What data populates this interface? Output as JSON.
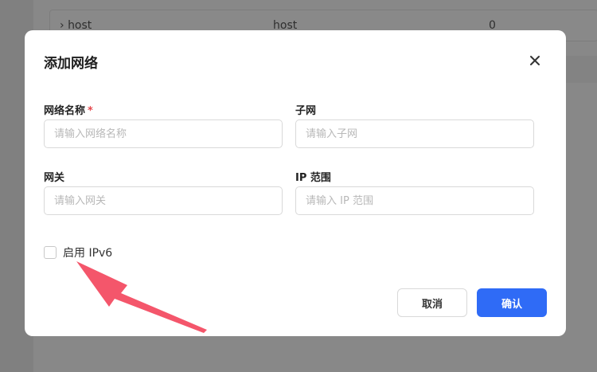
{
  "background": {
    "table_row": {
      "name": "host",
      "driver": "host",
      "count": "0"
    }
  },
  "dialog": {
    "title": "添加网络",
    "fields": {
      "name": {
        "label": "网络名称",
        "required_mark": "*",
        "placeholder": "请输入网络名称",
        "value": ""
      },
      "subnet": {
        "label": "子网",
        "placeholder": "请输入子网",
        "value": ""
      },
      "gateway": {
        "label": "网关",
        "placeholder": "请输入网关",
        "value": ""
      },
      "ip_range": {
        "label": "IP 范围",
        "placeholder": "请输入 IP 范围",
        "value": ""
      }
    },
    "ipv6": {
      "label": "启用 IPv6",
      "checked": false
    },
    "buttons": {
      "cancel": "取消",
      "confirm": "确认"
    }
  },
  "colors": {
    "primary": "#2f6bf6",
    "required": "#e5484d",
    "annotation_arrow": "#f4566b"
  },
  "icons": {
    "close": "close-icon",
    "expand": "chevron-right-icon"
  }
}
